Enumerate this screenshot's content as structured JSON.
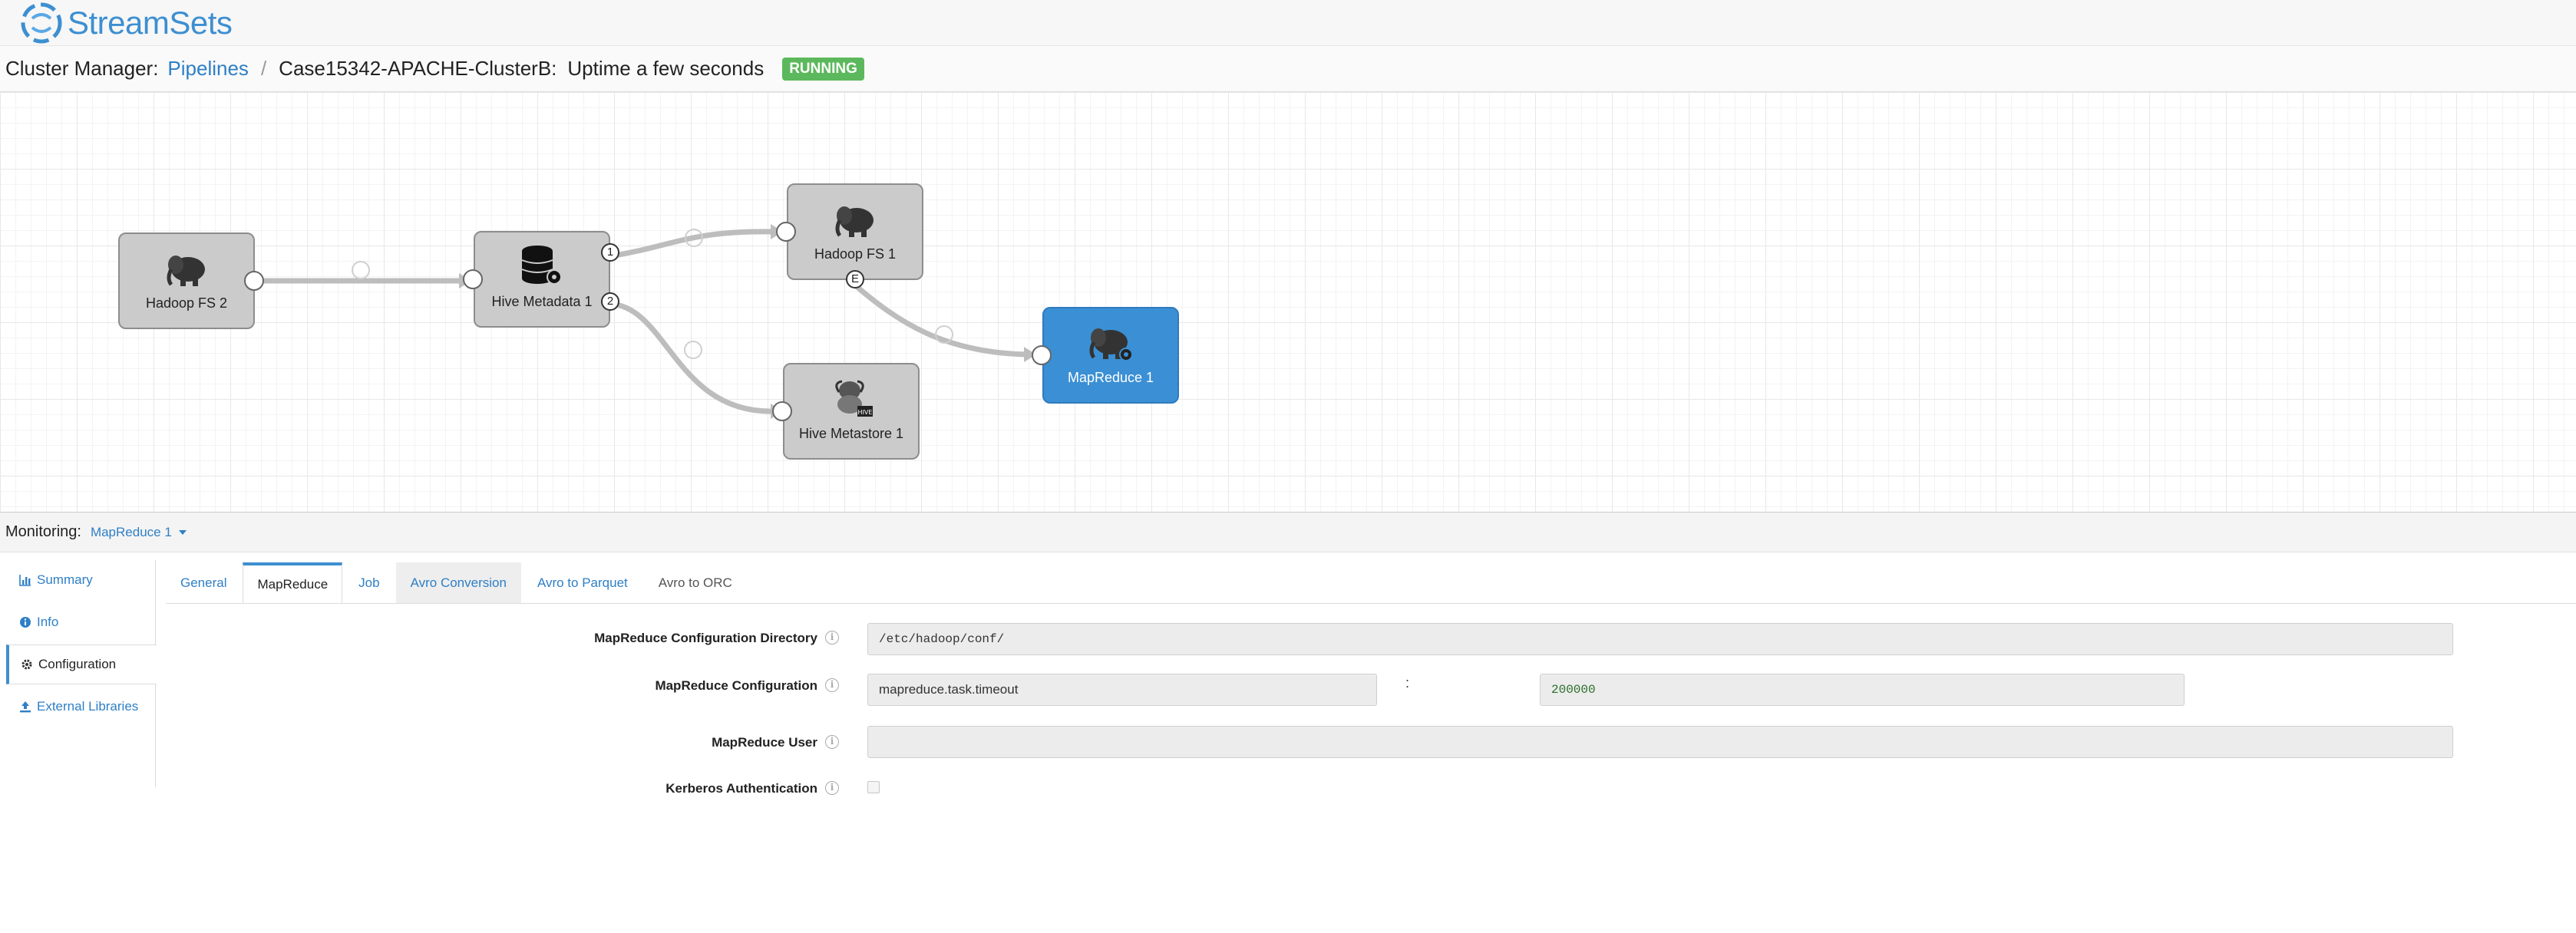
{
  "app": {
    "name": "StreamSets"
  },
  "breadcrumb": {
    "prefix": "Cluster Manager:",
    "link": "Pipelines",
    "separator": "/",
    "pipeline_name": "Case15342-APACHE-ClusterB:",
    "uptime": "Uptime  a few seconds",
    "status": "RUNNING"
  },
  "pipeline": {
    "nodes": [
      {
        "label": "Hadoop FS 2",
        "icon": "hadoop-elephant-icon"
      },
      {
        "label": "Hive Metadata 1",
        "icon": "database-gear-icon"
      },
      {
        "label": "Hadoop FS 1",
        "icon": "hadoop-elephant-icon"
      },
      {
        "label": "Hive Metastore 1",
        "icon": "hive-bee-icon"
      },
      {
        "label": "MapReduce 1",
        "icon": "hadoop-elephant-gear-icon"
      }
    ],
    "ports": {
      "out1": "1",
      "out2": "2",
      "event": "E"
    }
  },
  "monitoring": {
    "label": "Monitoring:",
    "selected": "MapReduce 1"
  },
  "leftnav": [
    {
      "label": "Summary",
      "icon": "bar-chart-icon"
    },
    {
      "label": "Info",
      "icon": "info-circle-icon"
    },
    {
      "label": "Configuration",
      "icon": "gear-icon",
      "active": true
    },
    {
      "label": "External Libraries",
      "icon": "upload-icon"
    }
  ],
  "tabs": [
    {
      "label": "General"
    },
    {
      "label": "MapReduce",
      "active": true
    },
    {
      "label": "Job"
    },
    {
      "label": "Avro Conversion"
    },
    {
      "label": "Avro to Parquet"
    },
    {
      "label": "Avro to ORC"
    }
  ],
  "form": {
    "config_dir": {
      "label": "MapReduce Configuration Directory",
      "value": "/etc/hadoop/conf/"
    },
    "config": {
      "label": "MapReduce Configuration",
      "key": "mapreduce.task.timeout",
      "separator": ":",
      "value": "200000"
    },
    "user": {
      "label": "MapReduce User",
      "value": ""
    },
    "kerberos": {
      "label": "Kerberos Authentication",
      "checked": false
    }
  },
  "colors": {
    "accent": "#3d8fd1",
    "running": "#5cb85c",
    "selected_node": "#3b8fd4"
  }
}
